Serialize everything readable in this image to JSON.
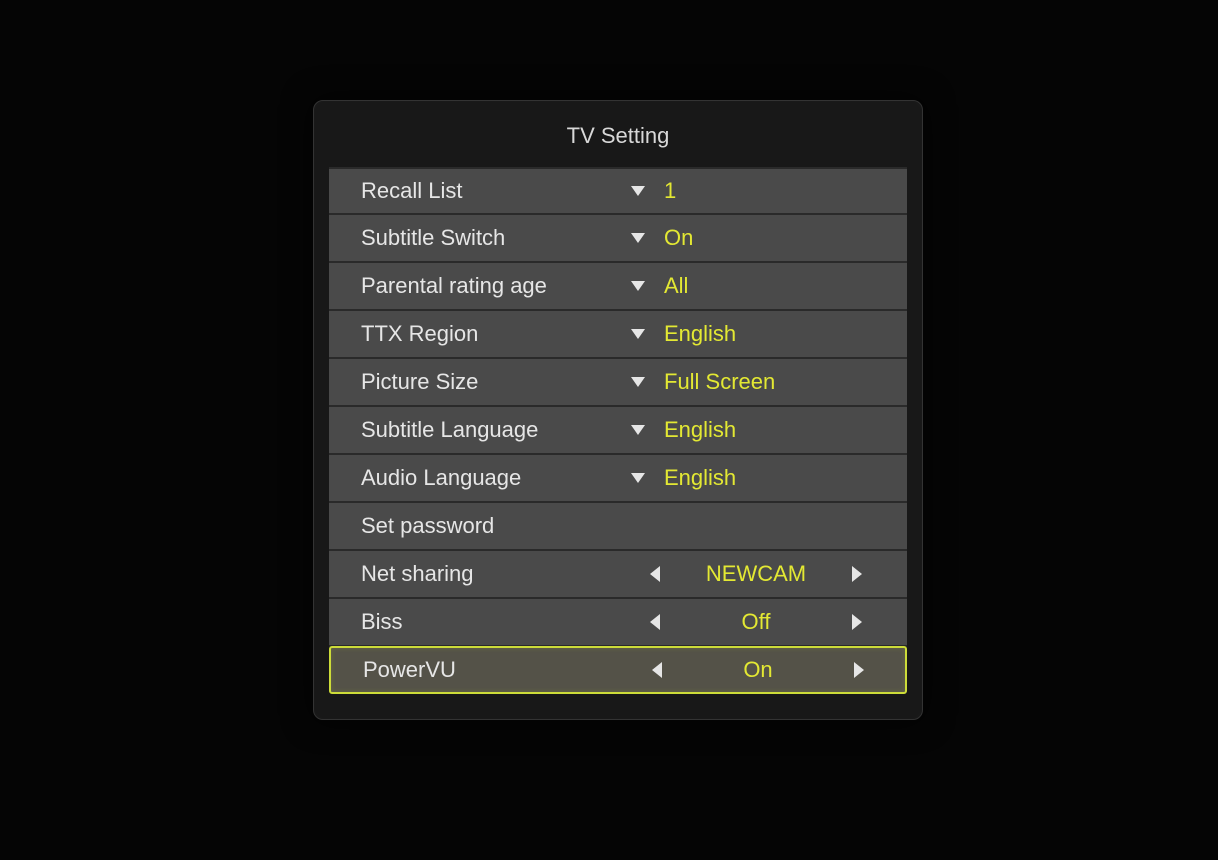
{
  "panel": {
    "title": "TV Setting",
    "rows": [
      {
        "kind": "dropdown",
        "label": "Recall List",
        "value": "1",
        "selected": false
      },
      {
        "kind": "dropdown",
        "label": "Subtitle Switch",
        "value": "On",
        "selected": false
      },
      {
        "kind": "dropdown",
        "label": "Parental rating age",
        "value": "All",
        "selected": false
      },
      {
        "kind": "dropdown",
        "label": "TTX Region",
        "value": "English",
        "selected": false
      },
      {
        "kind": "dropdown",
        "label": "Picture Size",
        "value": "Full Screen",
        "selected": false
      },
      {
        "kind": "dropdown",
        "label": "Subtitle Language",
        "value": "English",
        "selected": false
      },
      {
        "kind": "dropdown",
        "label": "Audio Language",
        "value": "English",
        "selected": false
      },
      {
        "kind": "action",
        "label": "Set password",
        "value": "",
        "selected": false
      },
      {
        "kind": "spinner",
        "label": "Net sharing",
        "value": "NEWCAM",
        "selected": false
      },
      {
        "kind": "spinner",
        "label": "Biss",
        "value": "Off",
        "selected": false
      },
      {
        "kind": "spinner",
        "label": "PowerVU",
        "value": "On",
        "selected": true
      }
    ]
  },
  "colors": {
    "accent": "#e3e833",
    "highlight_border": "#cddc39"
  }
}
